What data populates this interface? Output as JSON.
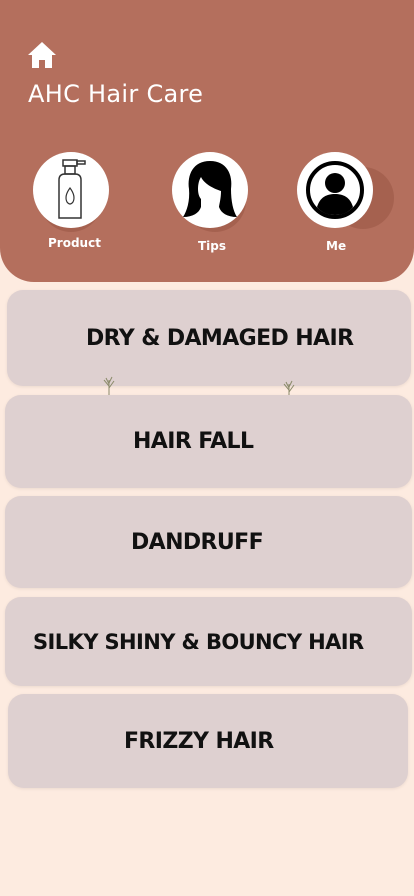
{
  "header": {
    "title": "AHC Hair Care",
    "icons": {
      "home": "home-icon"
    },
    "nav": [
      {
        "label": "Product",
        "icon": "product-bottle-icon"
      },
      {
        "label": "Tips",
        "icon": "woman-hair-icon"
      },
      {
        "label": "Me",
        "icon": "user-profile-icon"
      }
    ]
  },
  "categories": [
    {
      "label": "DRY & DAMAGED HAIR"
    },
    {
      "label": "HAIR FALL"
    },
    {
      "label": "DANDRUFF"
    },
    {
      "label": "SILKY SHINY & BOUNCY HAIR"
    },
    {
      "label": "FRIZZY HAIR"
    }
  ],
  "colors": {
    "header_bg": "#b46f5d",
    "page_bg": "#fdebe0",
    "card_bg": "#ded0d0",
    "text_dark": "#111111"
  }
}
